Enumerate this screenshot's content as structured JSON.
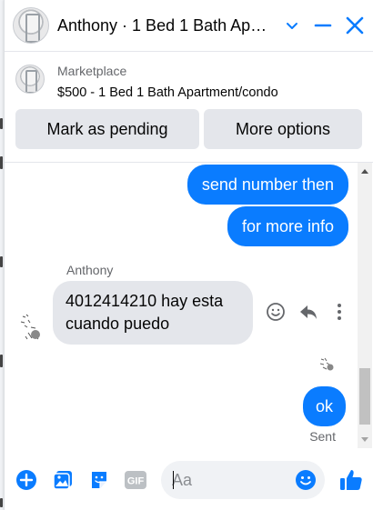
{
  "header": {
    "title": "Anthony · 1 Bed 1 Bath Apartment/condo",
    "avatar_icon": "apartment-photo-avatar",
    "minimize_icon": "minus-icon",
    "collapse_icon": "chevron-down-icon",
    "close_icon": "close-icon"
  },
  "marketplace": {
    "source": "Marketplace",
    "listing": "$500 - 1 Bed 1 Bath Apartment/condo",
    "mark_pending_label": "Mark as pending",
    "more_options_label": "More options"
  },
  "messages": {
    "outgoing": [
      "send number then",
      "for more info"
    ],
    "sender_name": "Anthony",
    "incoming_line1": "4012414210 hay esta",
    "incoming_line2": "cuando puedo",
    "last_outgoing": "ok",
    "status": "Sent"
  },
  "composer": {
    "placeholder": "Aa",
    "icons": [
      "add-circle-icon",
      "photo-icon",
      "sticker-icon",
      "gif-icon",
      "emoji-icon",
      "thumbs-up-icon"
    ]
  },
  "colors": {
    "accent": "#0a7cff",
    "incoming_bubble": "#e4e6eb",
    "button_bg": "#e4e6eb",
    "secondary_text": "#65676b"
  }
}
